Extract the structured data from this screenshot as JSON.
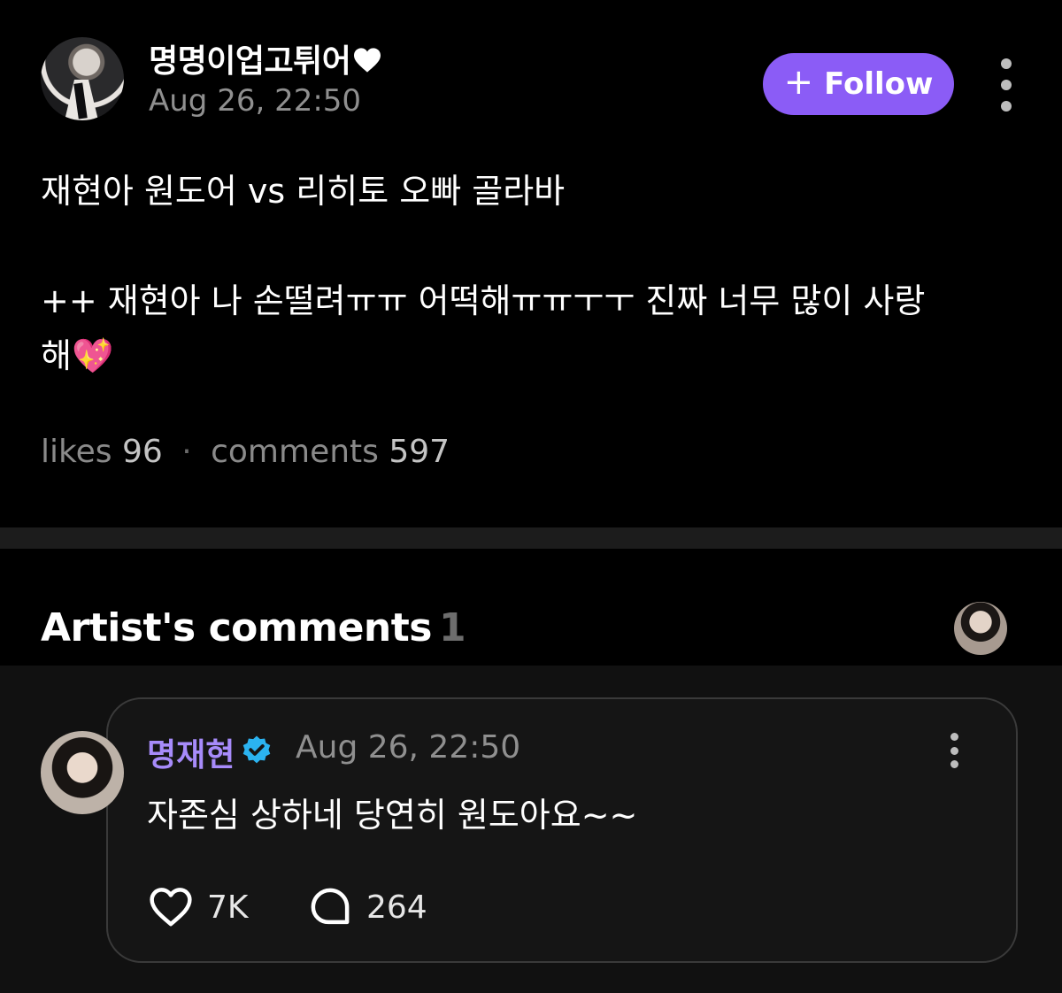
{
  "post": {
    "author_name": "명명이업고튀어",
    "author_badge_icon": "heart-icon",
    "timestamp": "Aug 26, 22:50",
    "follow": {
      "icon": "plus-icon",
      "label": "Follow"
    },
    "more_icon": "more-vertical-icon",
    "body": {
      "line1": "재현아 원도어 vs 리히토 오빠 골라바",
      "line2": "++ 재현아 나 손떨려ㅠㅠ 어떡해ㅠㅠㅜㅜ 진짜 너무 많이 사랑",
      "line3": "해💖"
    },
    "stats": {
      "likes_label": "likes",
      "likes_count": "96",
      "separator": "·",
      "comments_label": "comments",
      "comments_count": "597"
    }
  },
  "artist_comments": {
    "title": "Artist's comments",
    "count": "1",
    "comment": {
      "name": "명재현",
      "verified_icon": "verified-badge-icon",
      "timestamp": "Aug 26, 22:50",
      "text": "자존심 상하네 당연히 원도아요~~",
      "likes": "7K",
      "replies": "264"
    }
  },
  "colors": {
    "background": "#000000",
    "accent": "#8b5cf6",
    "artist_name": "#a78bfa",
    "verified": "#2bb3f0",
    "muted": "#8f8f8f"
  }
}
